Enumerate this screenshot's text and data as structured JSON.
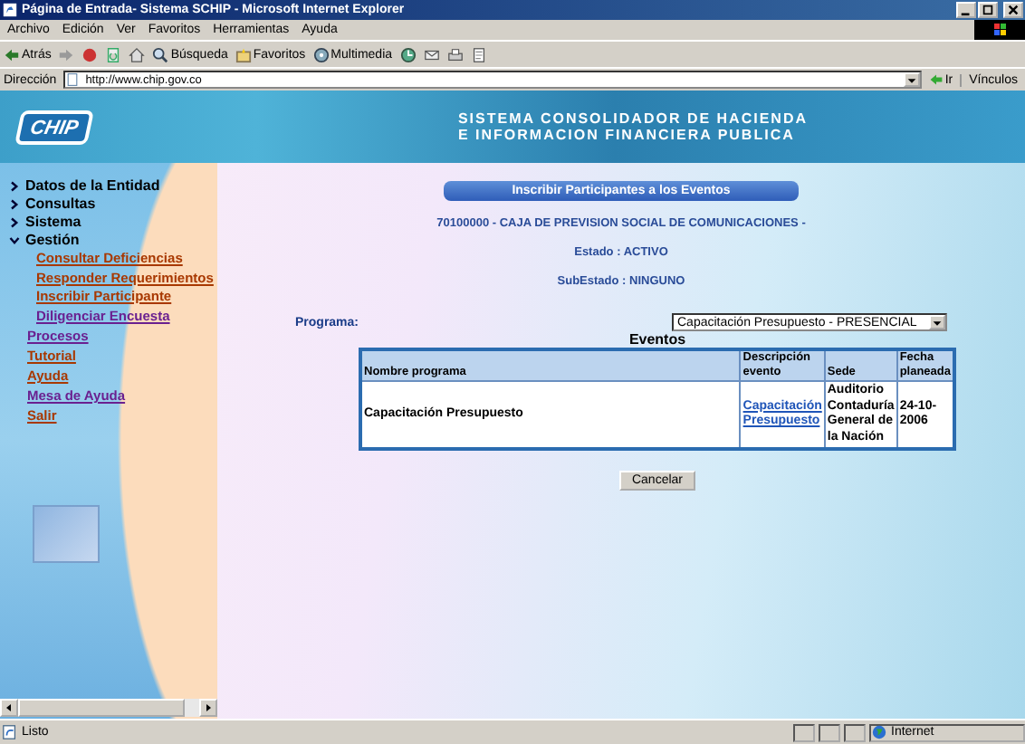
{
  "window": {
    "title": "Página de Entrada- Sistema SCHIP - Microsoft Internet Explorer"
  },
  "menu": [
    "Archivo",
    "Edición",
    "Ver",
    "Favoritos",
    "Herramientas",
    "Ayuda"
  ],
  "toolbar": [
    {
      "kind": "back",
      "label": "Atrás"
    },
    {
      "kind": "forward"
    },
    {
      "kind": "stop"
    },
    {
      "kind": "refresh"
    },
    {
      "kind": "home"
    },
    {
      "kind": "search",
      "label": "Búsqueda"
    },
    {
      "kind": "favorites",
      "label": "Favoritos"
    },
    {
      "kind": "media",
      "label": "Multimedia"
    },
    {
      "kind": "history"
    },
    {
      "kind": "mail"
    },
    {
      "kind": "print"
    },
    {
      "kind": "edit"
    }
  ],
  "address": {
    "label": "Dirección",
    "value": "http://www.chip.gov.co",
    "go": "Ir",
    "links": "Vínculos"
  },
  "banner": {
    "logo": "CHIP",
    "lines": [
      "SISTEMA CONSOLIDADOR DE HACIENDA",
      "E INFORMACION FINANCIERA PUBLICA"
    ]
  },
  "sidebar": {
    "items": [
      {
        "label": "Datos de la Entidad",
        "expanded": false
      },
      {
        "label": "Consultas",
        "expanded": false
      },
      {
        "label": "Sistema",
        "expanded": false
      },
      {
        "label": "Gestión",
        "expanded": true,
        "children": [
          {
            "label": "Consultar Deficiencias",
            "visited": false
          },
          {
            "label": "Responder Requerimientos",
            "visited": false
          },
          {
            "label": "Inscribir Participante",
            "visited": false
          },
          {
            "label": "Diligenciar Encuesta",
            "visited": true
          }
        ]
      }
    ],
    "links": [
      {
        "label": "Procesos",
        "visited": true
      },
      {
        "label": "Tutorial",
        "visited": false
      },
      {
        "label": "Ayuda",
        "visited": false
      },
      {
        "label": "Mesa de Ayuda",
        "visited": true
      },
      {
        "label": "Salir",
        "visited": false
      }
    ]
  },
  "content": {
    "heading": "Inscribir Participantes a los Eventos",
    "entity": "70100000 - CAJA DE PREVISION SOCIAL DE COMUNICACIONES -",
    "estado": "Estado : ACTIVO",
    "subestado": "SubEstado : NINGUNO",
    "program_label": "Programa:",
    "program_value": "Capacitación Presupuesto - PRESENCIAL",
    "table": {
      "title": "Eventos",
      "columns": [
        "Nombre programa",
        "Descripción evento",
        "Sede",
        "Fecha planeada"
      ],
      "rows": [
        [
          "Capacitación Presupuesto",
          "Capacitación Presupuesto",
          "Auditorio Contaduría General de la Nación",
          "24-10-2006"
        ]
      ]
    },
    "cancel": "Cancelar"
  },
  "status_bar": {
    "text": "Listo",
    "zone": "Internet"
  }
}
